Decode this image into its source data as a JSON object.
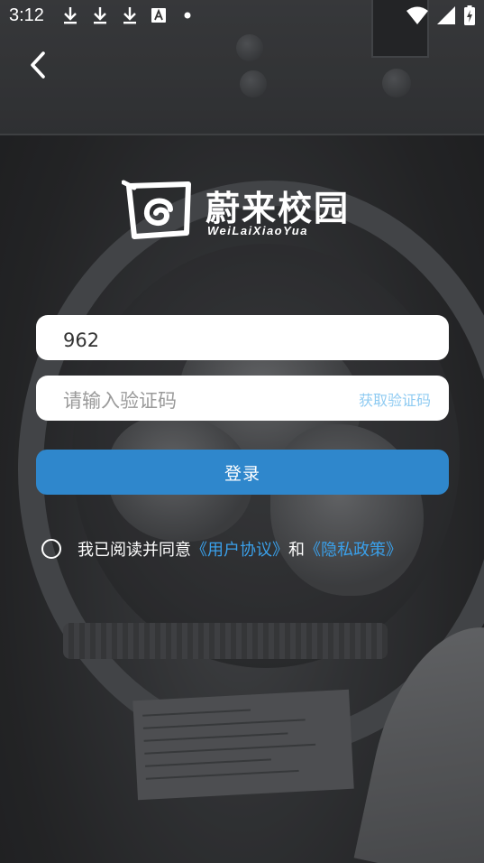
{
  "status_bar": {
    "time": "3:12",
    "icons": [
      "download-icon",
      "download-icon",
      "download-icon",
      "text-notification-icon",
      "dot-icon",
      "wifi-icon",
      "signal-icon",
      "battery-charging-icon"
    ]
  },
  "header": {
    "back_icon": "chevron-left-icon"
  },
  "logo": {
    "title": "蔚来校园",
    "subtitle": "WeiLaiXiaoYua"
  },
  "form": {
    "phone_value": "962",
    "code_placeholder": "请输入验证码",
    "get_code_label": "获取验证码",
    "login_label": "登录"
  },
  "agreement": {
    "prefix": "我已阅读并同意",
    "user_agreement": "《用户协议》",
    "conjunction": "和",
    "privacy_policy": "《隐私政策》"
  },
  "colors": {
    "primary": "#2f87cc",
    "link": "#3aa0ea",
    "get_code": "#8fcbf2"
  }
}
